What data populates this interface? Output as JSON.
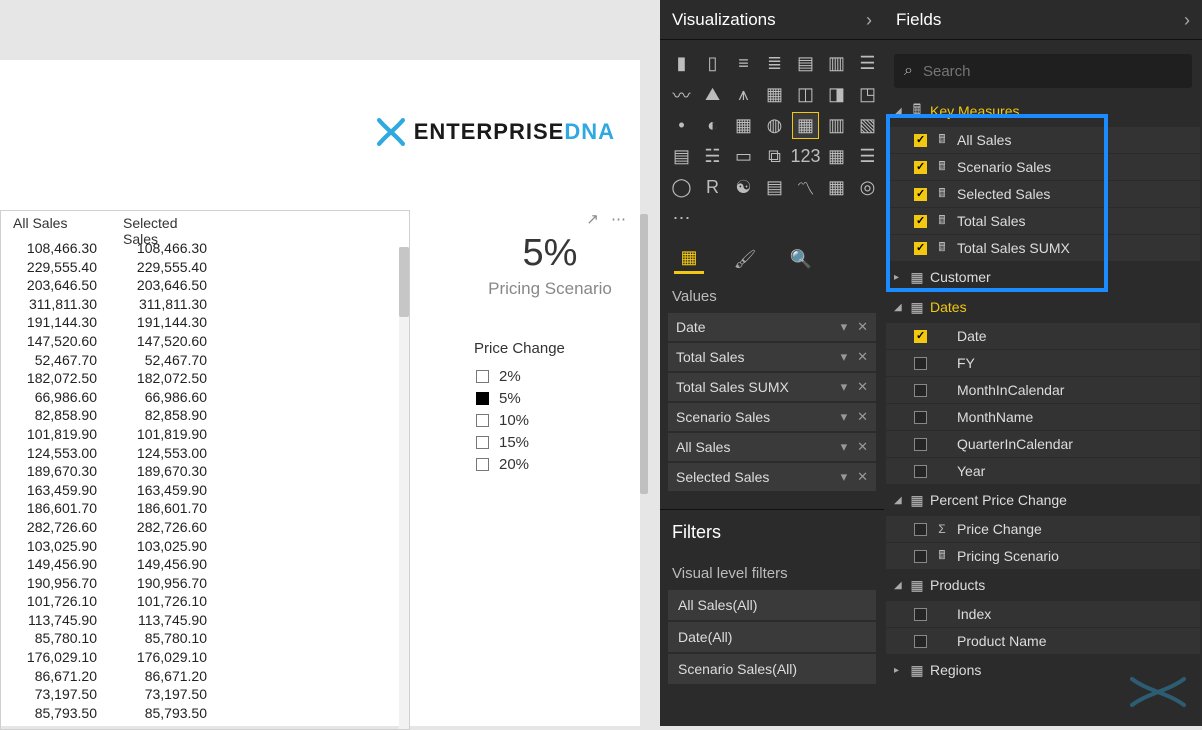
{
  "canvas": {
    "logo_text_a": "ENTERPRISE ",
    "logo_text_b": "DNA"
  },
  "table": {
    "headers": {
      "col1": "All Sales",
      "col2": "Selected Sales"
    },
    "rows": [
      {
        "c1": "108,466.30",
        "c2": "108,466.30"
      },
      {
        "c1": "229,555.40",
        "c2": "229,555.40"
      },
      {
        "c1": "203,646.50",
        "c2": "203,646.50"
      },
      {
        "c1": "311,811.30",
        "c2": "311,811.30"
      },
      {
        "c1": "191,144.30",
        "c2": "191,144.30"
      },
      {
        "c1": "147,520.60",
        "c2": "147,520.60"
      },
      {
        "c1": "52,467.70",
        "c2": "52,467.70"
      },
      {
        "c1": "182,072.50",
        "c2": "182,072.50"
      },
      {
        "c1": "66,986.60",
        "c2": "66,986.60"
      },
      {
        "c1": "82,858.90",
        "c2": "82,858.90"
      },
      {
        "c1": "101,819.90",
        "c2": "101,819.90"
      },
      {
        "c1": "124,553.00",
        "c2": "124,553.00"
      },
      {
        "c1": "189,670.30",
        "c2": "189,670.30"
      },
      {
        "c1": "163,459.90",
        "c2": "163,459.90"
      },
      {
        "c1": "186,601.70",
        "c2": "186,601.70"
      },
      {
        "c1": "282,726.60",
        "c2": "282,726.60"
      },
      {
        "c1": "103,025.90",
        "c2": "103,025.90"
      },
      {
        "c1": "149,456.90",
        "c2": "149,456.90"
      },
      {
        "c1": "190,956.70",
        "c2": "190,956.70"
      },
      {
        "c1": "101,726.10",
        "c2": "101,726.10"
      },
      {
        "c1": "113,745.90",
        "c2": "113,745.90"
      },
      {
        "c1": "85,780.10",
        "c2": "85,780.10"
      },
      {
        "c1": "176,029.10",
        "c2": "176,029.10"
      },
      {
        "c1": "86,671.20",
        "c2": "86,671.20"
      },
      {
        "c1": "73,197.50",
        "c2": "73,197.50"
      },
      {
        "c1": "85,793.50",
        "c2": "85,793.50"
      }
    ]
  },
  "card": {
    "value": "5%",
    "label": "Pricing Scenario"
  },
  "slicer": {
    "title": "Price Change",
    "options": [
      {
        "label": "2%",
        "selected": false
      },
      {
        "label": "5%",
        "selected": true
      },
      {
        "label": "10%",
        "selected": false
      },
      {
        "label": "15%",
        "selected": false
      },
      {
        "label": "20%",
        "selected": false
      }
    ]
  },
  "vispane": {
    "title": "Visualizations",
    "values_label": "Values",
    "wells": [
      "Date",
      "Total Sales",
      "Total Sales SUMX",
      "Scenario Sales",
      "All Sales",
      "Selected Sales"
    ],
    "filters_title": "Filters",
    "filters_sub": "Visual level filters",
    "filters": [
      "All Sales(All)",
      "Date(All)",
      "Scenario Sales(All)"
    ]
  },
  "fieldpane": {
    "title": "Fields",
    "search_placeholder": "Search",
    "groups": [
      {
        "name": "Key Measures",
        "gold": true,
        "expanded": true,
        "icon": "calc",
        "items": [
          {
            "label": "All Sales",
            "checked": true,
            "icon": "calc"
          },
          {
            "label": "Scenario Sales",
            "checked": true,
            "icon": "calc"
          },
          {
            "label": "Selected Sales",
            "checked": true,
            "icon": "calc"
          },
          {
            "label": "Total Sales",
            "checked": true,
            "icon": "calc"
          },
          {
            "label": "Total Sales SUMX",
            "checked": true,
            "icon": "calc"
          }
        ]
      },
      {
        "name": "Customer",
        "gold": false,
        "expanded": false,
        "icon": "table",
        "items": []
      },
      {
        "name": "Dates",
        "gold": true,
        "expanded": true,
        "icon": "table",
        "items": [
          {
            "label": "Date",
            "checked": true,
            "icon": ""
          },
          {
            "label": "FY",
            "checked": false,
            "icon": ""
          },
          {
            "label": "MonthInCalendar",
            "checked": false,
            "icon": ""
          },
          {
            "label": "MonthName",
            "checked": false,
            "icon": ""
          },
          {
            "label": "QuarterInCalendar",
            "checked": false,
            "icon": ""
          },
          {
            "label": "Year",
            "checked": false,
            "icon": ""
          }
        ]
      },
      {
        "name": "Percent Price Change",
        "gold": false,
        "expanded": true,
        "icon": "table",
        "items": [
          {
            "label": "Price Change",
            "checked": false,
            "icon": "sigma"
          },
          {
            "label": "Pricing Scenario",
            "checked": false,
            "icon": "calc"
          }
        ]
      },
      {
        "name": "Products",
        "gold": false,
        "expanded": true,
        "icon": "table",
        "items": [
          {
            "label": "Index",
            "checked": false,
            "icon": ""
          },
          {
            "label": "Product Name",
            "checked": false,
            "icon": ""
          }
        ]
      },
      {
        "name": "Regions",
        "gold": false,
        "expanded": false,
        "icon": "table",
        "items": []
      }
    ]
  }
}
